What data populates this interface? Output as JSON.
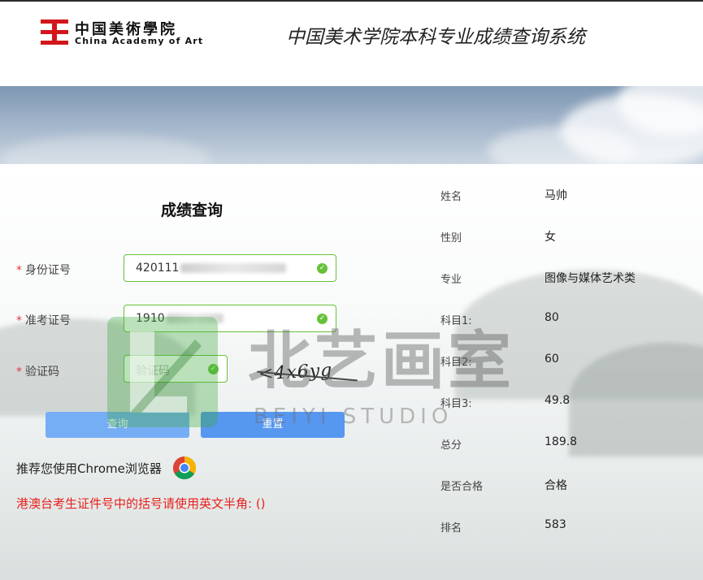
{
  "header": {
    "logo_cn": "中国美術學院",
    "logo_en": "China Academy of Art",
    "system_title": "中国美术学院本科专业成绩查询系统"
  },
  "form": {
    "title": "成绩查询",
    "required_mark": "*",
    "id_label": "身份证号",
    "id_value": "420111",
    "exam_label": "准考证号",
    "exam_value": "1910",
    "captcha_label": "验证码",
    "captcha_placeholder": "验证码",
    "captcha_text": "<4x6yg",
    "query_button": "查询",
    "reset_button": "重置"
  },
  "recommend_text": "推荐您使用Chrome浏览器",
  "notice_text": "港澳台考生证件号中的括号请使用英文半角: ()",
  "result": [
    {
      "label": "姓名",
      "value": "马帅"
    },
    {
      "label": "性别",
      "value": "女"
    },
    {
      "label": "专业",
      "value": "图像与媒体艺术类"
    },
    {
      "label": "科目1:",
      "value": "80"
    },
    {
      "label": "科目2:",
      "value": "60"
    },
    {
      "label": "科目3:",
      "value": "49.8"
    },
    {
      "label": "总分",
      "value": "189.8"
    },
    {
      "label": "是否合格",
      "value": "合格"
    },
    {
      "label": "排名",
      "value": "583"
    }
  ],
  "watermark": {
    "cn": "北艺画室",
    "en": "BEIYI STUDIO"
  },
  "colors": {
    "brand_red": "#d2161c",
    "valid_green": "#67c23a",
    "query_button": "#76aef5",
    "reset_button": "#5697f0",
    "notice_red": "#e8211c"
  }
}
